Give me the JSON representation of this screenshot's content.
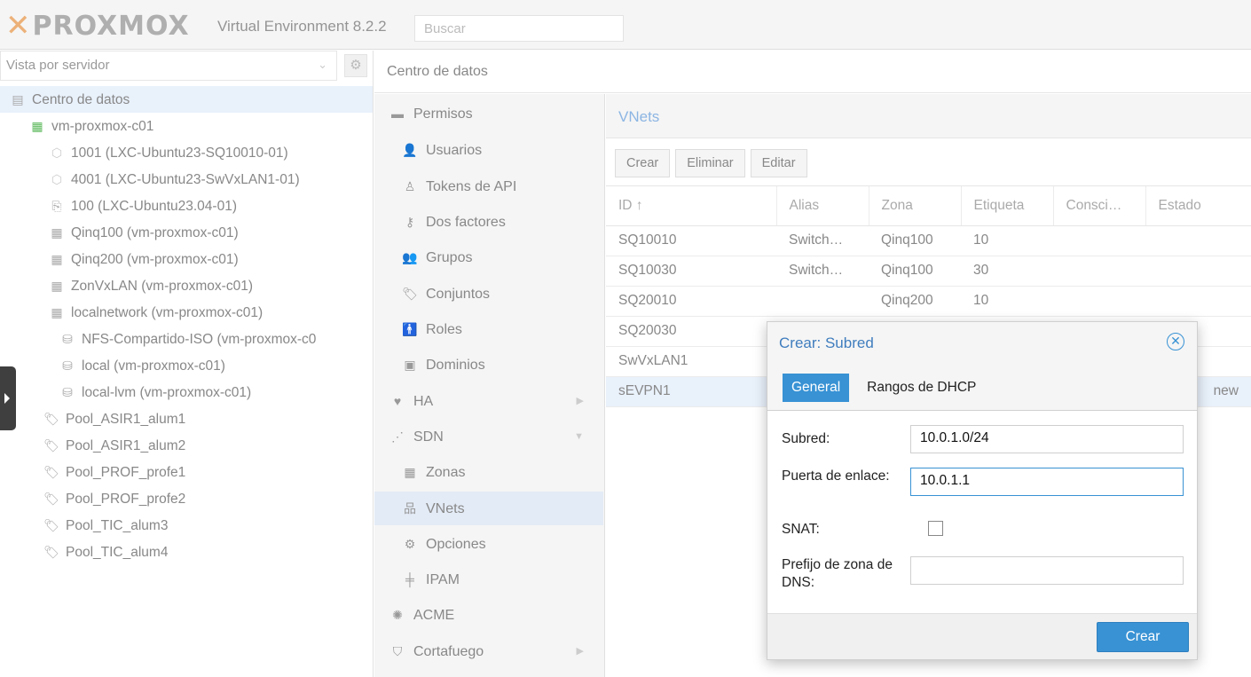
{
  "header": {
    "logo_text": "PROXMOX",
    "product": "Virtual Environment 8.2.2",
    "search_placeholder": "Buscar"
  },
  "tree": {
    "view_selector": "Vista por servidor",
    "nodes": [
      {
        "label": "Centro de datos",
        "icon": "datacenter-icon"
      },
      {
        "label": "vm-proxmox-c01",
        "icon": "server-online-icon"
      },
      {
        "label": "1001 (LXC-Ubuntu23-SQ10010-01)",
        "icon": "container-icon"
      },
      {
        "label": "4001 (LXC-Ubuntu23-SwVxLAN1-01)",
        "icon": "container-icon"
      },
      {
        "label": "100 (LXC-Ubuntu23.04-01)",
        "icon": "container-template-icon"
      },
      {
        "label": "Qinq100 (vm-proxmox-c01)",
        "icon": "sdn-zone-icon"
      },
      {
        "label": "Qinq200 (vm-proxmox-c01)",
        "icon": "sdn-zone-icon"
      },
      {
        "label": "ZonVxLAN (vm-proxmox-c01)",
        "icon": "sdn-zone-icon"
      },
      {
        "label": "localnetwork (vm-proxmox-c01)",
        "icon": "sdn-zone-icon"
      },
      {
        "label": "NFS-Compartido-ISO (vm-proxmox-c0",
        "icon": "storage-icon"
      },
      {
        "label": "local (vm-proxmox-c01)",
        "icon": "storage-icon"
      },
      {
        "label": "local-lvm (vm-proxmox-c01)",
        "icon": "storage-icon"
      },
      {
        "label": "Pool_ASIR1_alum1",
        "icon": "tag-icon"
      },
      {
        "label": "Pool_ASIR1_alum2",
        "icon": "tag-icon"
      },
      {
        "label": "Pool_PROF_profe1",
        "icon": "tag-icon"
      },
      {
        "label": "Pool_PROF_profe2",
        "icon": "tag-icon"
      },
      {
        "label": "Pool_TIC_alum3",
        "icon": "tag-icon"
      },
      {
        "label": "Pool_TIC_alum4",
        "icon": "tag-icon"
      }
    ]
  },
  "breadcrumb": "Centro de datos",
  "menu": [
    {
      "label": "Permisos",
      "icon": "minus-icon"
    },
    {
      "label": "Usuarios",
      "icon": "user-icon"
    },
    {
      "label": "Tokens de API",
      "icon": "user-outline-icon"
    },
    {
      "label": "Dos factores",
      "icon": "key-icon"
    },
    {
      "label": "Grupos",
      "icon": "users-icon"
    },
    {
      "label": "Conjuntos",
      "icon": "tags-icon"
    },
    {
      "label": "Roles",
      "icon": "male-icon"
    },
    {
      "label": "Dominios",
      "icon": "address-book-icon"
    },
    {
      "label": "HA",
      "icon": "heartbeat-icon"
    },
    {
      "label": "SDN",
      "icon": "sdn-icon"
    },
    {
      "label": "Zonas",
      "icon": "grid-icon"
    },
    {
      "label": "VNets",
      "icon": "network-icon"
    },
    {
      "label": "Opciones",
      "icon": "gear-icon"
    },
    {
      "label": "IPAM",
      "icon": "ipam-icon"
    },
    {
      "label": "ACME",
      "icon": "certificate-icon"
    },
    {
      "label": "Cortafuego",
      "icon": "shield-icon"
    }
  ],
  "vnets": {
    "title": "VNets",
    "toolbar": {
      "create": "Crear",
      "delete": "Eliminar",
      "edit": "Editar"
    },
    "columns": [
      "ID ↑",
      "Alias",
      "Zona",
      "Etiqueta",
      "Consci…",
      "Estado"
    ],
    "rows": [
      [
        "SQ10010",
        "Switch…",
        "Qinq100",
        "10",
        "",
        ""
      ],
      [
        "SQ10030",
        "Switch…",
        "Qinq100",
        "30",
        "",
        ""
      ],
      [
        "SQ20010",
        "",
        "Qinq200",
        "10",
        "",
        ""
      ],
      [
        "SQ20030",
        "",
        "",
        "",
        "",
        ""
      ],
      [
        "SwVxLAN1",
        "",
        "",
        "",
        "",
        ""
      ],
      [
        "sEVPN1",
        "",
        "",
        "",
        "",
        "new"
      ]
    ]
  },
  "dialog": {
    "title": "Crear: Subred",
    "tabs": [
      "General",
      "Rangos de DHCP"
    ],
    "fields": {
      "subnet_label": "Subred:",
      "subnet_value": "10.0.1.0/24",
      "gateway_label": "Puerta de enlace:",
      "gateway_value": "10.0.1.1",
      "snat_label": "SNAT:",
      "snat_checked": false,
      "dns_prefix_label": "Prefijo de zona de DNS:",
      "dns_prefix_value": ""
    },
    "submit": "Crear"
  },
  "colors": {
    "accent": "#3892d4",
    "brand_orange": "#e57000"
  }
}
